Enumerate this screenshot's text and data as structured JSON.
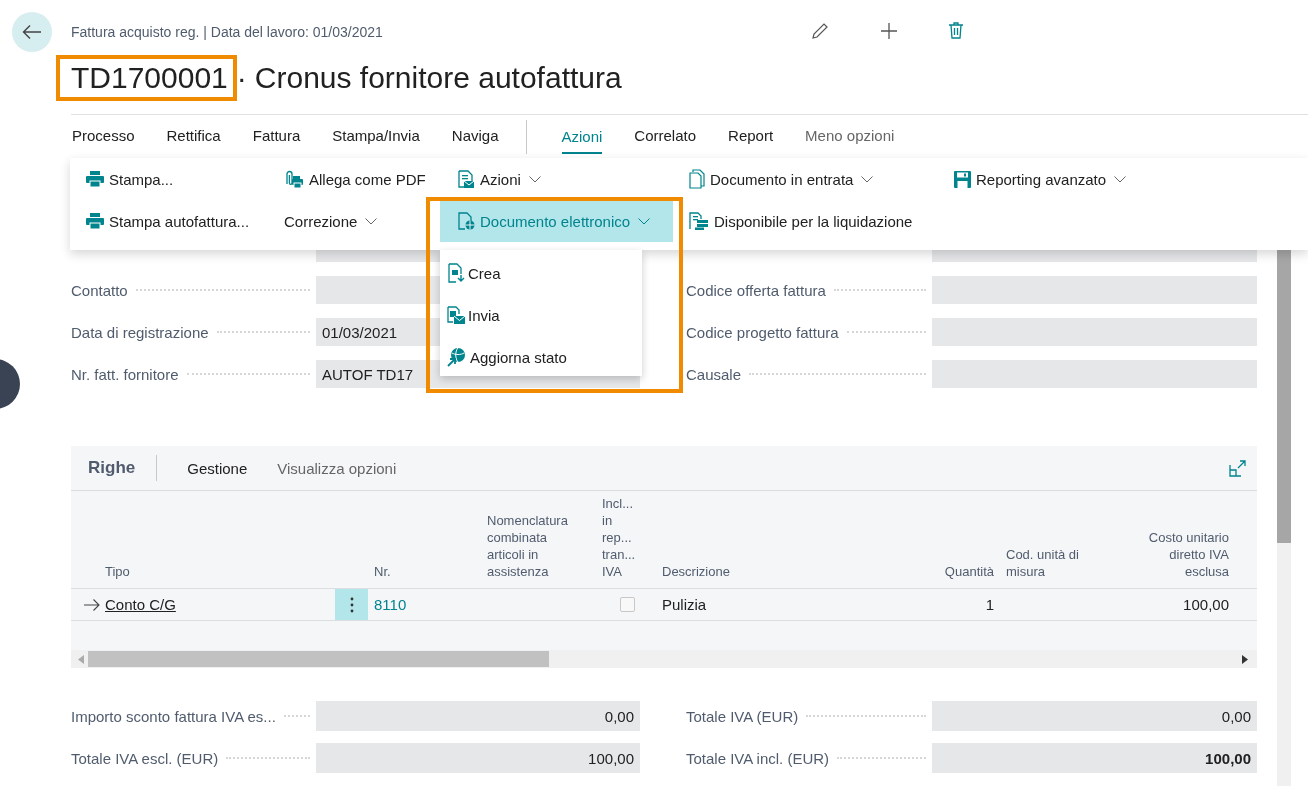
{
  "header": {
    "breadcrumb": "Fattura acquisto reg. | Data del lavoro: 01/03/2021",
    "number": "TD1700001",
    "number_highlighted": true,
    "separator": "·",
    "title": "Cronus fornitore autofattura"
  },
  "action_tabs": [
    {
      "kind": "tab",
      "label": "Processo",
      "selected": false
    },
    {
      "kind": "tab",
      "label": "Rettifica",
      "selected": false
    },
    {
      "kind": "tab",
      "label": "Fattura",
      "selected": false
    },
    {
      "kind": "tab",
      "label": "Stampa/Invia",
      "selected": false
    },
    {
      "kind": "tab",
      "label": "Naviga",
      "selected": false
    },
    {
      "kind": "divider"
    },
    {
      "kind": "tab",
      "label": "Azioni",
      "selected": true
    },
    {
      "kind": "tab",
      "label": "Correlato",
      "selected": false
    },
    {
      "kind": "tab",
      "label": "Report",
      "selected": false
    },
    {
      "kind": "more",
      "label": "Meno opzioni"
    }
  ],
  "actions_panel": {
    "columns": [
      [
        {
          "label": "Stampa...",
          "dropdown": false,
          "selected": false
        },
        {
          "label": "Stampa autofattura...",
          "dropdown": false,
          "selected": false
        }
      ],
      [
        {
          "label": "Allega come PDF",
          "dropdown": false,
          "selected": false
        },
        {
          "label": "Correzione",
          "dropdown": true,
          "selected": false
        }
      ],
      [
        {
          "label": "Azioni",
          "dropdown": true,
          "selected": false
        },
        {
          "label": "Documento elettronico",
          "dropdown": true,
          "selected": true
        }
      ],
      [
        {
          "label": "Documento in entrata",
          "dropdown": true,
          "selected": false
        },
        {
          "label": "Disponibile per la liquidazione",
          "dropdown": false,
          "selected": false
        }
      ],
      [
        {
          "label": "Reporting avanzato",
          "dropdown": true,
          "selected": false
        }
      ]
    ]
  },
  "submenu": {
    "highlighted": true,
    "items": [
      {
        "label": "Crea"
      },
      {
        "label": "Invia"
      },
      {
        "label": "Aggiorna stato"
      }
    ]
  },
  "fields": {
    "left": [
      {
        "label": "Contatto"
      },
      {
        "label": "Data di registrazione",
        "value": "01/03/2021"
      },
      {
        "label": "Nr. fatt. fornitore",
        "value": "AUTOF TD17"
      }
    ],
    "right": [
      {
        "label": "Codice offerta fattura"
      },
      {
        "label": "Codice progetto fattura"
      },
      {
        "label": "Causale"
      }
    ]
  },
  "lines": {
    "title": "Righe",
    "actions": [
      "Gestione",
      "Visualizza opzioni"
    ],
    "columns": [
      {
        "label": "Tipo",
        "kind": "text"
      },
      {
        "label": "Nr.",
        "kind": "text"
      },
      {
        "label": "Nomenclatura combinata articoli in assistenza",
        "kind": "text"
      },
      {
        "label": "Incl... in rep... tran... IVA",
        "kind": "check"
      },
      {
        "label": "Descrizione",
        "kind": "text"
      },
      {
        "label": "Quantità",
        "kind": "number"
      },
      {
        "label": "Cod. unità di misura",
        "kind": "text"
      },
      {
        "label": "Costo unitario diretto IVA esclusa",
        "kind": "number"
      }
    ],
    "rows": [
      {
        "current": true,
        "type": "Conto C/G",
        "no": "8110",
        "included": false,
        "description": "Pulizia",
        "quantity": "1",
        "unit_cost": "100,00"
      }
    ]
  },
  "totals": {
    "left": [
      {
        "label": "Importo sconto fattura IVA es...",
        "value": "0,00",
        "bold": false
      },
      {
        "label": "Totale IVA escl. (EUR)",
        "value": "100,00",
        "bold": false
      }
    ],
    "right": [
      {
        "label": "Totale IVA (EUR)",
        "value": "0,00",
        "bold": false
      },
      {
        "label": "Totale IVA incl. (EUR)",
        "value": "100,00",
        "bold": true
      }
    ]
  }
}
